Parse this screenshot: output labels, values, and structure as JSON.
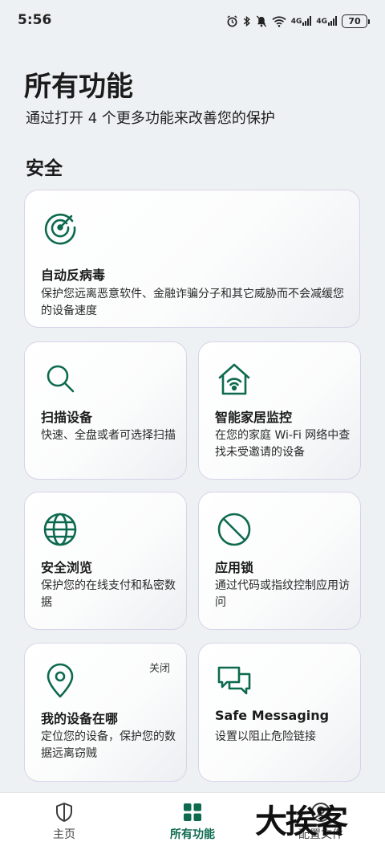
{
  "status_bar": {
    "time": "5:56",
    "network_1": "4G",
    "network_2": "4G",
    "battery": "70",
    "icons": [
      "alarm-icon",
      "bluetooth-icon",
      "mute-icon",
      "wifi-icon",
      "signal-icon",
      "signal-icon",
      "battery-icon"
    ]
  },
  "header": {
    "title": "所有功能",
    "subtitle": "通过打开 4 个更多功能来改善您的保护"
  },
  "section": {
    "title": "安全"
  },
  "cards": [
    {
      "icon": "radar-scan-icon",
      "title": "自动反病毒",
      "desc": "保护您远离恶意软件、金融诈骗分子和其它威胁而不会减缓您的设备速度"
    },
    {
      "icon": "magnifier-icon",
      "title": "扫描设备",
      "desc": "快速、全盘或者可选择扫描"
    },
    {
      "icon": "smart-home-wifi-icon",
      "title": "智能家居监控",
      "desc": "在您的家庭 Wi-Fi 网络中查找未受邀请的设备"
    },
    {
      "icon": "globe-icon",
      "title": "安全浏览",
      "desc": "保护您的在线支付和私密数据"
    },
    {
      "icon": "block-icon",
      "title": "应用锁",
      "desc": "通过代码或指纹控制应用访问"
    },
    {
      "icon": "location-pin-icon",
      "title": "我的设备在哪",
      "desc": "定位您的设备，保护您的数据远离窃贼",
      "status": "关闭"
    },
    {
      "icon": "chat-bubbles-icon",
      "title": "Safe Messaging",
      "desc": "设置以阻止危险链接"
    }
  ],
  "bottom_nav": {
    "items": [
      {
        "icon": "shield-icon",
        "label": "主页"
      },
      {
        "icon": "grid-icon",
        "label": "所有功能",
        "active": true
      },
      {
        "icon": "profile-icon",
        "label": "配置文件"
      }
    ]
  },
  "watermark": "大挨客",
  "colors": {
    "accent": "#0d6a4f",
    "background": "#eef1f3",
    "card_border": "#d7d3ea"
  }
}
